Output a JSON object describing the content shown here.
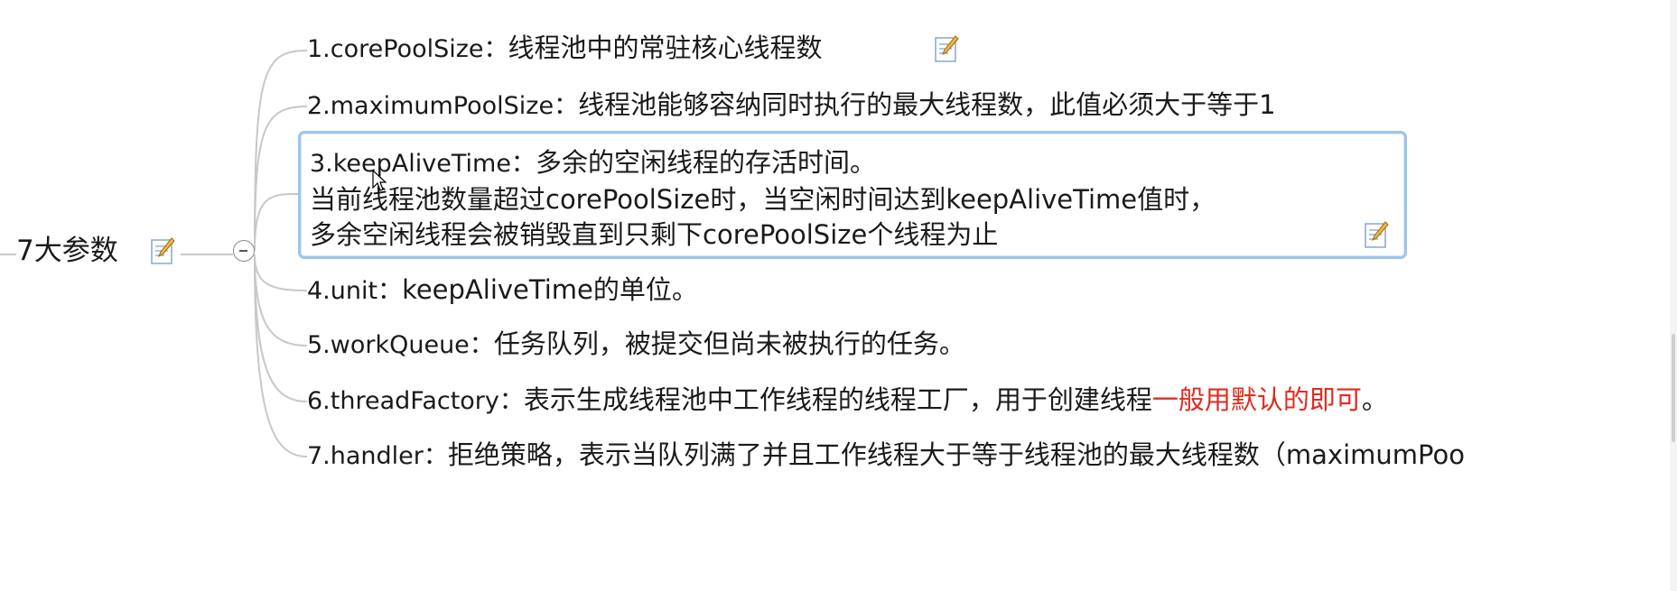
{
  "mindmap": {
    "root": {
      "label": "7大参数",
      "note_icon": "note-pencil-icon"
    },
    "topics": [
      {
        "key": "1.corePoolSize：",
        "text": "线程池中的常驻核心线程数",
        "has_note": true
      },
      {
        "key": "2.maximumPoolSize：",
        "text": "线程池能够容纳同时执行的最大线程数，此值必须大于等于1"
      },
      {
        "key": "3.keepAliveTime：",
        "text": "多余的空闲线程的存活时间。",
        "line2": "当前线程池数量超过corePoolSize时，当空闲时间达到keepAliveTime值时，",
        "line3": "多余空闲线程会被销毁直到只剩下corePoolSize个线程为止",
        "selected": true,
        "has_note": true
      },
      {
        "key": "4.unit：",
        "text": "keepAliveTime的单位。"
      },
      {
        "key": "5.workQueue：",
        "text": "任务队列，被提交但尚未被执行的任务。"
      },
      {
        "key": "6.threadFactory：",
        "text": "表示生成线程池中工作线程的线程工厂，用于创建线程",
        "highlight": "一般用默认的即可",
        "tail": "。"
      },
      {
        "key": "7.handler：",
        "text": "拒绝策略，表示当队列满了并且工作线程大于等于线程池的最大线程数（maximumPoo"
      }
    ]
  },
  "colors": {
    "selection_border": "#9cc6ef",
    "highlight_text": "#e02b1f",
    "connector": "#c8c8c8"
  }
}
